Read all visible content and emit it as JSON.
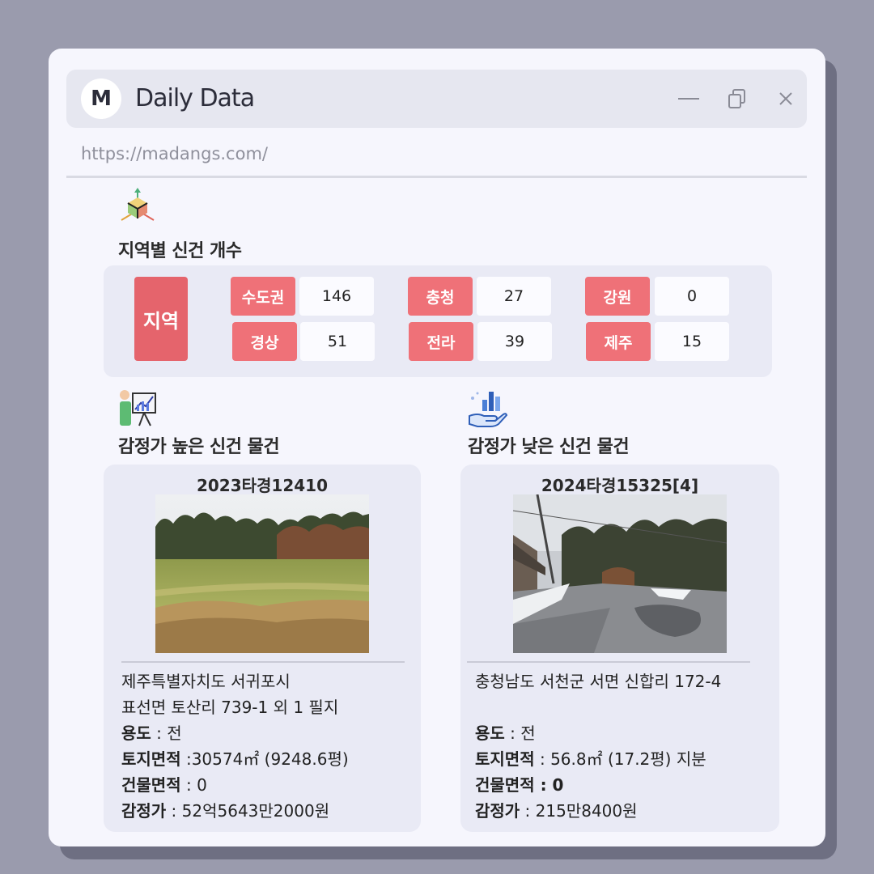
{
  "window": {
    "logo_letter": "M",
    "title": "Daily Data",
    "url": "https://madangs.com/",
    "minimize_icon": "minimize-icon",
    "copy_icon": "copy-icon",
    "close_icon": "close-icon"
  },
  "region_section": {
    "title": "지역별 신건 개수",
    "main_label": "지역",
    "regions": [
      {
        "name": "수도권",
        "count": "146"
      },
      {
        "name": "충청",
        "count": "27"
      },
      {
        "name": "강원",
        "count": "0"
      },
      {
        "name": "경상",
        "count": "51"
      },
      {
        "name": "전라",
        "count": "39"
      },
      {
        "name": "제주",
        "count": "15"
      }
    ]
  },
  "high_section": {
    "title": "감정가 높은 신건 물건",
    "case_no": "2023타경12410",
    "address_line1": "제주특별자치도 서귀포시",
    "address_line2": "표선면 토산리 739-1 외 1 필지",
    "usage_label": "용도",
    "usage_value": " : 전",
    "land_label": "토지면적",
    "land_value": " :30574㎡ (9248.6평)",
    "building_label": "건물면적",
    "building_value": " : 0",
    "appraisal_label": "감정가",
    "appraisal_value": " : 52억5643만2000원"
  },
  "low_section": {
    "title": "감정가 낮은 신건 물건",
    "case_no": "2024타경15325[4]",
    "address_line1": "충청남도 서천군 서면 신합리 172-4",
    "address_line2": "",
    "usage_label": "용도",
    "usage_value": " : 전",
    "land_label": "토지면적",
    "land_value": " : 56.8㎡ (17.2평) 지분",
    "building_label": "건물면적",
    "building_value": " : 0",
    "appraisal_label": "감정가",
    "appraisal_value": " : 215만8400원"
  },
  "colors": {
    "accent": "#ef7178",
    "accent_dark": "#e5646c",
    "panel": "#e9eaf5",
    "background": "#9a9bad"
  }
}
